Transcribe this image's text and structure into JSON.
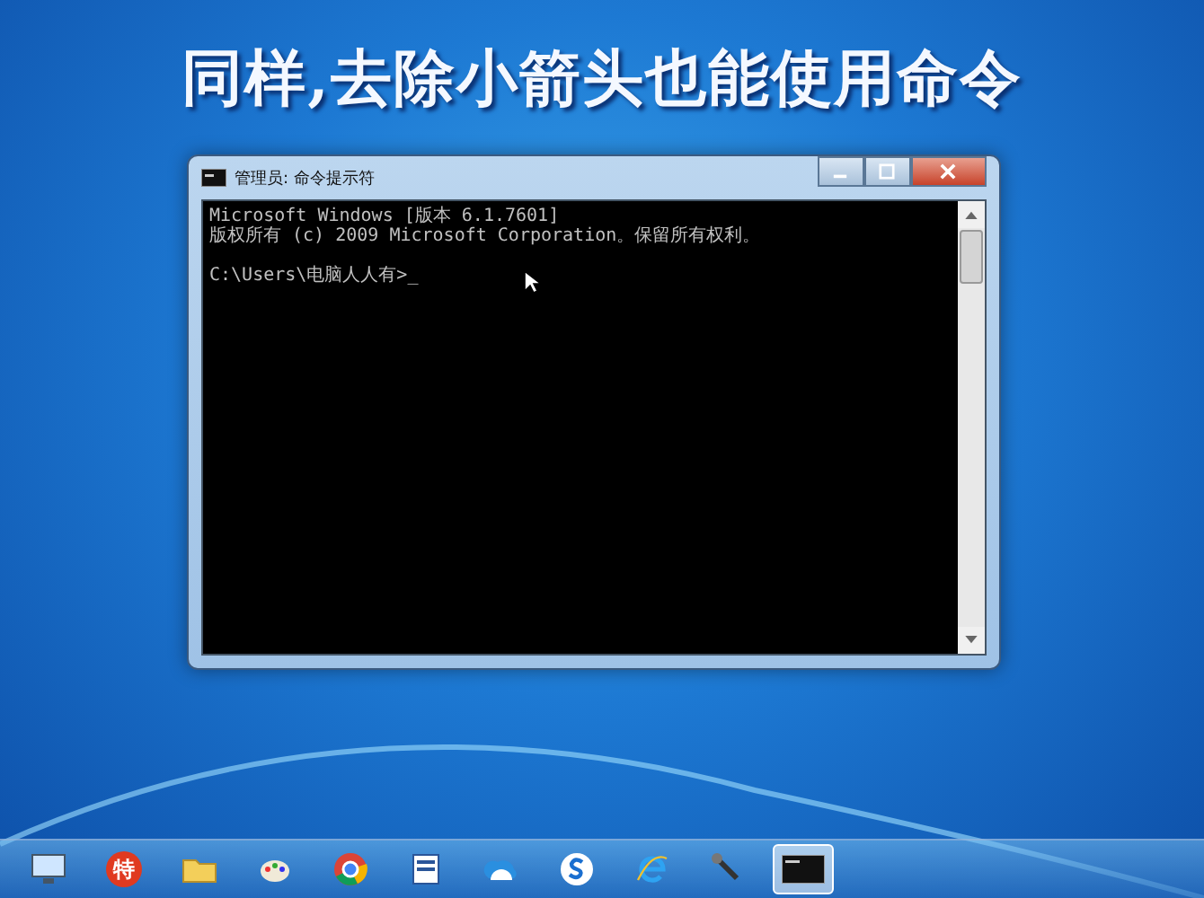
{
  "caption": "同样,去除小箭头也能使用命令",
  "console_window": {
    "title": "管理员: 命令提示符",
    "lines": [
      "Microsoft Windows [版本 6.1.7601]",
      "版权所有 (c) 2009 Microsoft Corporation。保留所有权利。"
    ],
    "prompt": "C:\\Users\\电脑人人有>_"
  },
  "taskbar": {
    "items": [
      {
        "selected": false
      },
      {
        "label": "特",
        "selected": false
      },
      {
        "selected": false
      },
      {
        "selected": false
      },
      {
        "selected": false
      },
      {
        "selected": false
      },
      {
        "selected": false
      },
      {
        "selected": false
      },
      {
        "selected": false
      },
      {
        "selected": false
      },
      {
        "selected": true
      }
    ]
  }
}
